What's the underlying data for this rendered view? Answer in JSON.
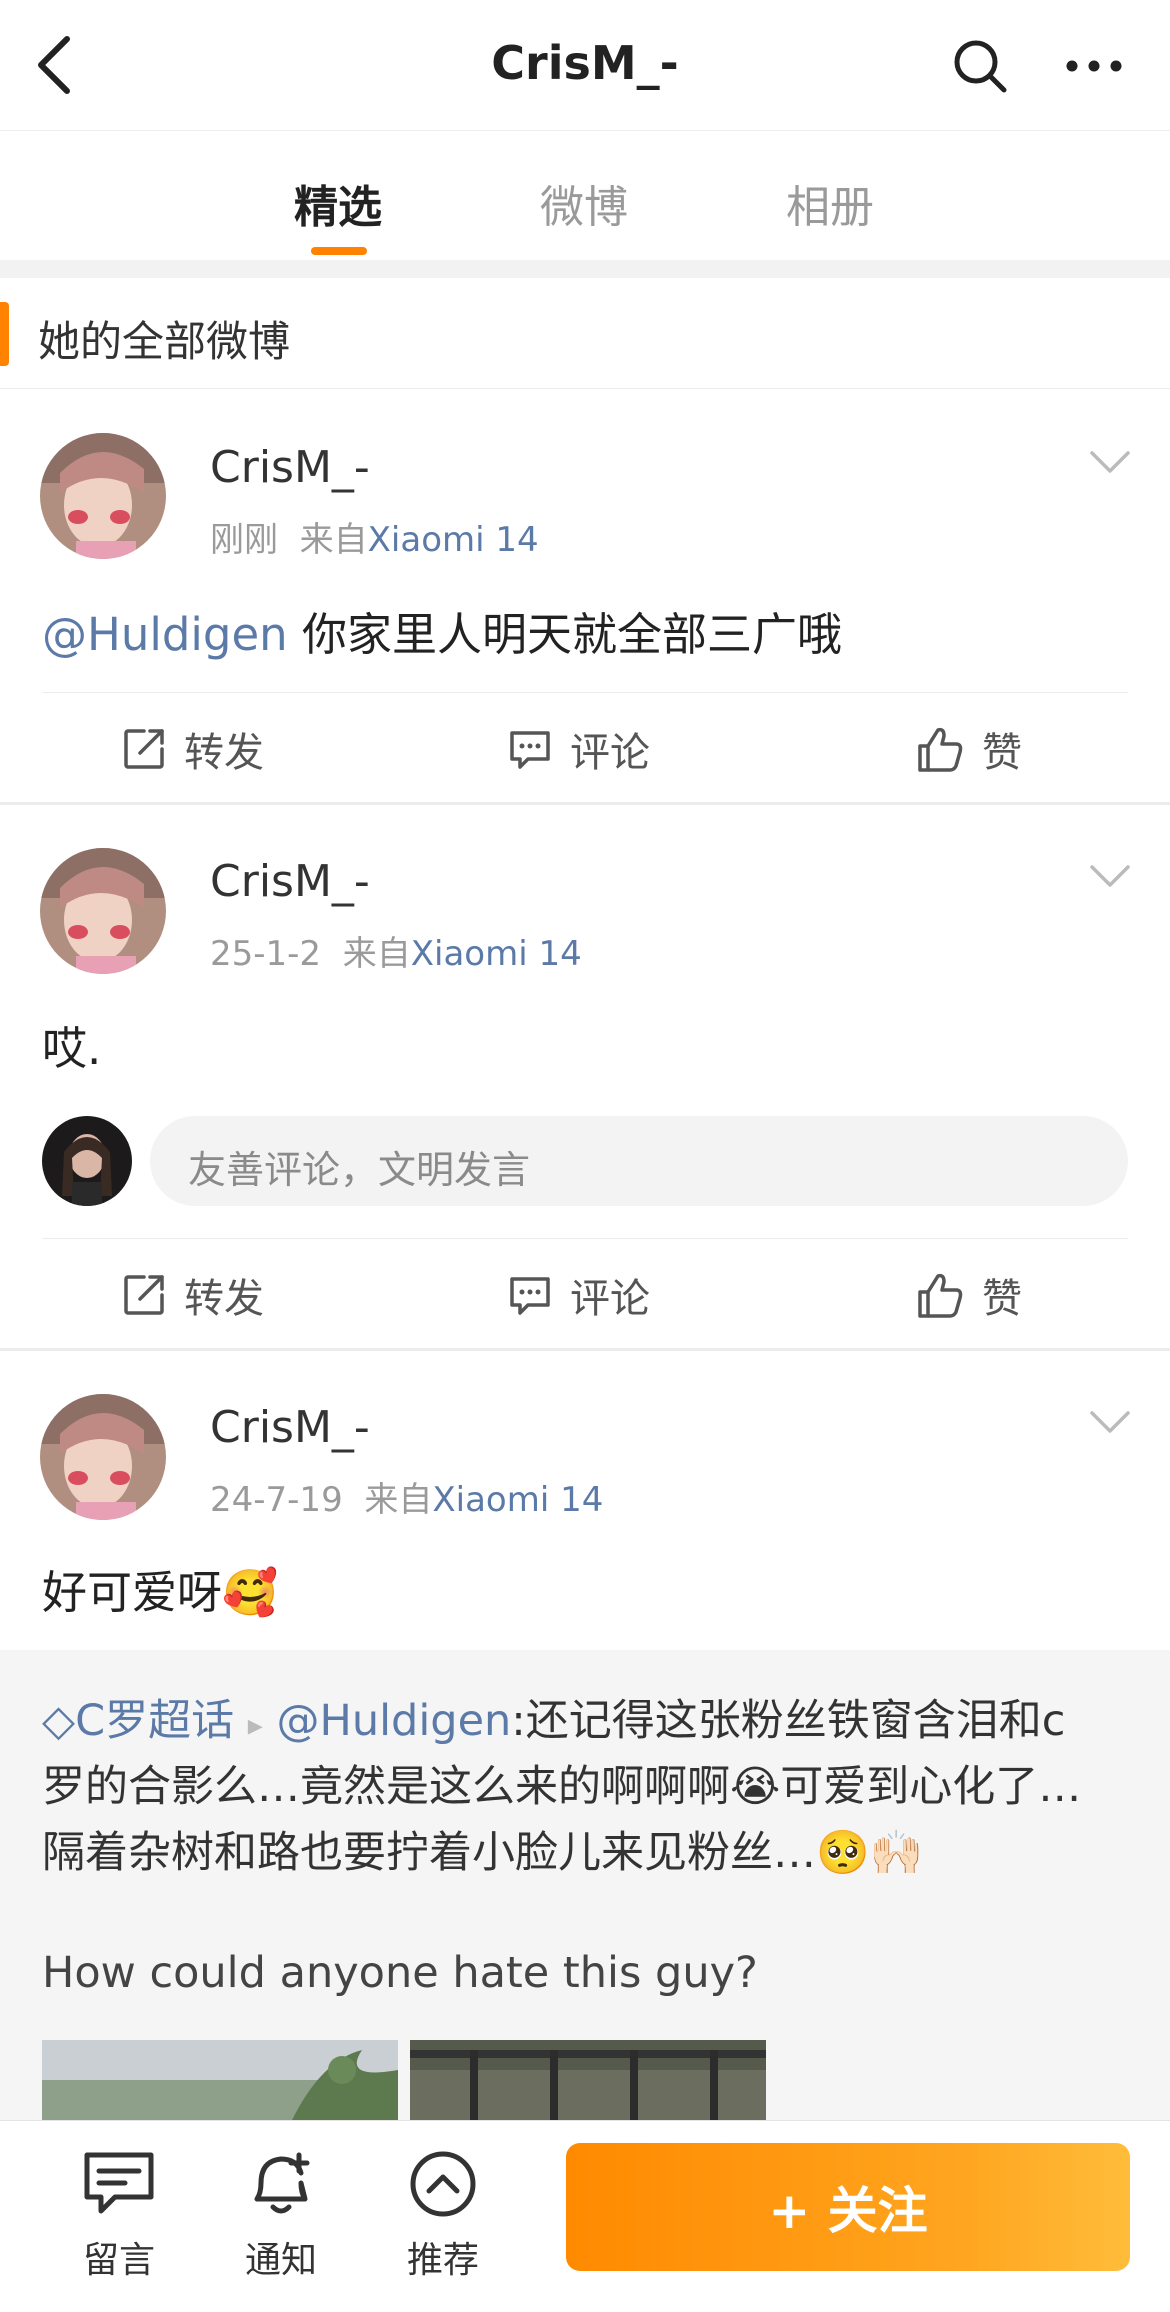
{
  "header": {
    "title": "CrisM_-"
  },
  "tabs": [
    {
      "label": "精选",
      "active": true
    },
    {
      "label": "微博",
      "active": false
    },
    {
      "label": "相册",
      "active": false
    }
  ],
  "section": {
    "title": "她的全部微博"
  },
  "posts": [
    {
      "username": "CrisM_-",
      "time": "刚刚",
      "from_prefix": "来自",
      "source": "Xiaomi 14",
      "mention": "@Huldigen",
      "text": " 你家里人明天就全部三广哦"
    },
    {
      "username": "CrisM_-",
      "time": "25-1-2",
      "from_prefix": "来自",
      "source": "Xiaomi 14",
      "text": "哎.",
      "comment_placeholder": "友善评论，文明发言"
    },
    {
      "username": "CrisM_-",
      "time": "24-7-19",
      "from_prefix": "来自",
      "source": "Xiaomi 14",
      "text": "好可爱呀",
      "emoji": "🥰",
      "repost": {
        "topic": "C罗超话",
        "mention": "@Huldigen",
        "line1": ":还记得这张粉丝铁窗含泪和c",
        "line2": "罗的合影么…竟然是这么来的啊啊啊",
        "line2_emoji": "😭",
        "line2_tail": "可爱到心化了…",
        "line3": "隔着杂树和路也要拧着小脸儿来见粉丝…",
        "line3_emoji": "🥺🙌🏻",
        "english": "How could anyone hate this guy?"
      }
    }
  ],
  "actions": {
    "repost": "转发",
    "comment": "评论",
    "like": "赞"
  },
  "bottom": {
    "message": "留言",
    "notify": "通知",
    "recommend": "推荐",
    "follow": "+ 关注"
  },
  "colors": {
    "accent": "#ff8200",
    "link": "#5b7aa8"
  }
}
